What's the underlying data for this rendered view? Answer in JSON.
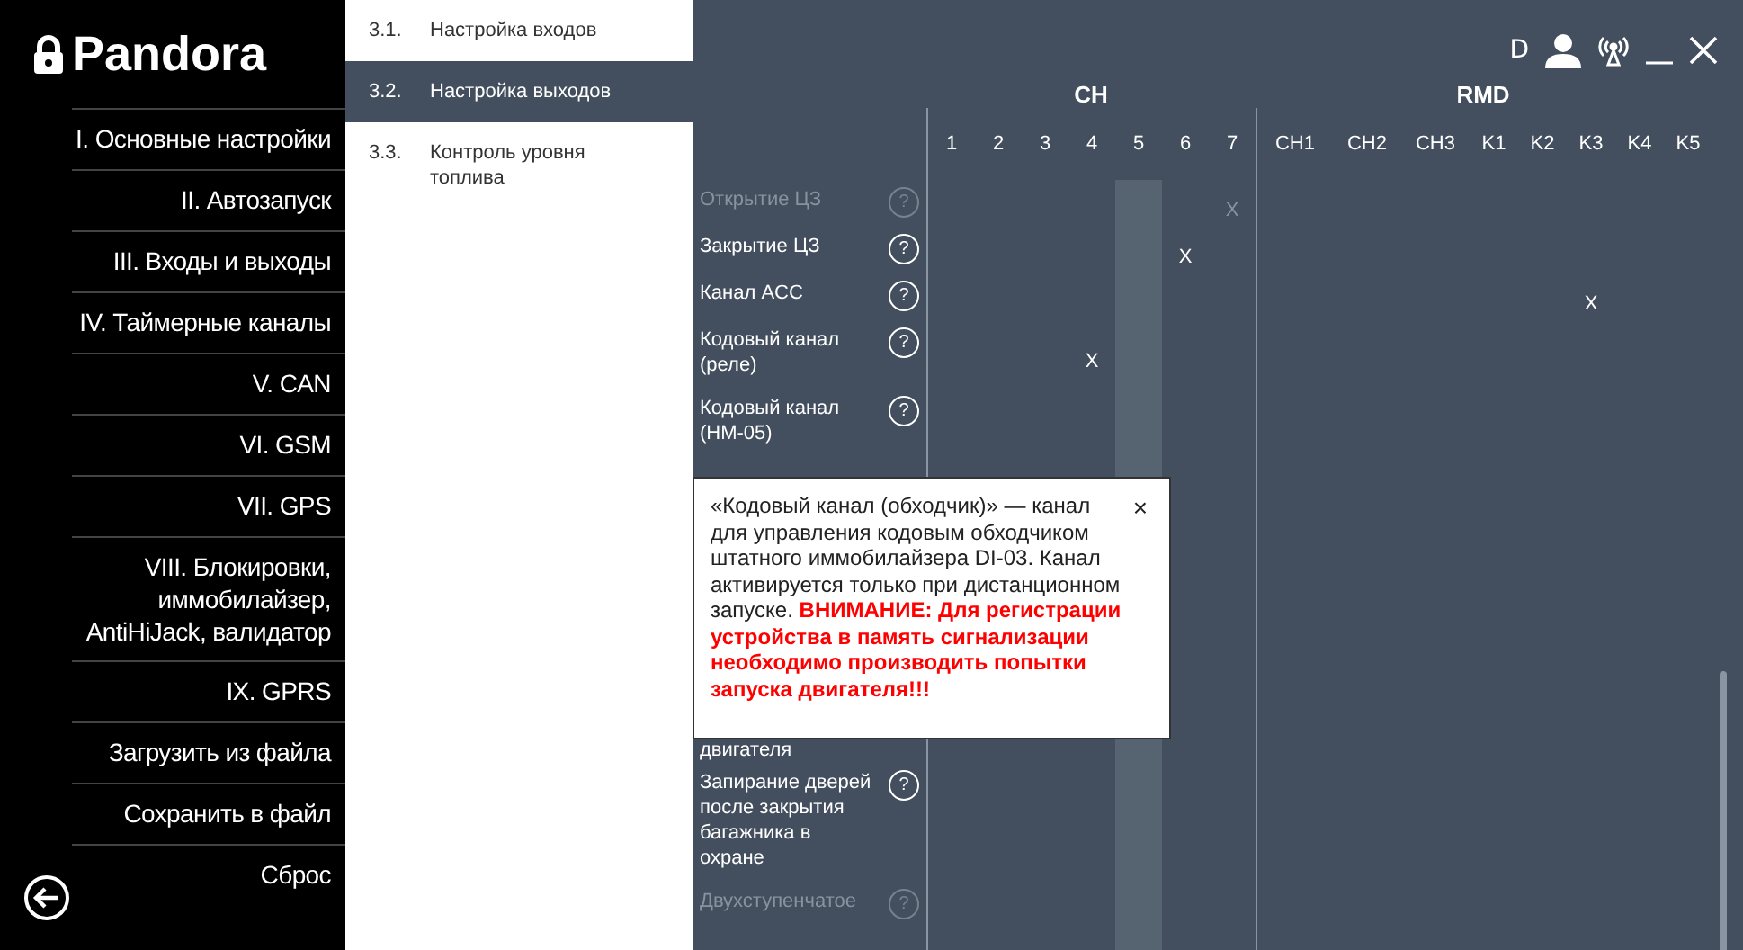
{
  "logo": {
    "text": "Pandora"
  },
  "menu": [
    {
      "label": "I. Основные настройки"
    },
    {
      "label": "II. Автозапуск"
    },
    {
      "label": "III. Входы и выходы"
    },
    {
      "label": "IV. Таймерные каналы"
    },
    {
      "label": "V. CAN"
    },
    {
      "label": "VI. GSM"
    },
    {
      "label": "VII. GPS"
    },
    {
      "label": "VIII. Блокировки, иммобилайзер, AntiHiJack, валидатор"
    },
    {
      "label": "IX. GPRS"
    },
    {
      "label": "Загрузить из файла"
    },
    {
      "label": "Сохранить в файл"
    },
    {
      "label": "Сброс"
    }
  ],
  "submenu": [
    {
      "number": "3.1.",
      "label": "Настройка входов",
      "selected": false
    },
    {
      "number": "3.2.",
      "label": "Настройка выходов",
      "selected": true
    },
    {
      "number": "3.3.",
      "label": "Контроль уровня топлива",
      "selected": false
    }
  ],
  "header": {
    "device_letter": "D"
  },
  "table": {
    "help_symbol": "?",
    "groups": [
      {
        "label": "CH",
        "columns": [
          {
            "label": "1",
            "selected": false
          },
          {
            "label": "2",
            "selected": false
          },
          {
            "label": "3",
            "selected": false
          },
          {
            "label": "4",
            "selected": false
          },
          {
            "label": "5",
            "selected": true
          },
          {
            "label": "6",
            "selected": false
          },
          {
            "label": "7",
            "selected": false
          }
        ]
      },
      {
        "label": "RMD",
        "columns": [
          {
            "label": "CH1",
            "selected": false
          },
          {
            "label": "CH2",
            "selected": false
          },
          {
            "label": "CH3",
            "selected": false
          },
          {
            "label": "K1",
            "selected": false
          },
          {
            "label": "K2",
            "selected": false
          },
          {
            "label": "K3",
            "selected": false
          },
          {
            "label": "K4",
            "selected": false
          },
          {
            "label": "K5",
            "selected": false
          }
        ]
      }
    ],
    "rows": [
      {
        "kind": "row",
        "label": "Открытие ЦЗ",
        "faded": true,
        "cells": [
          {},
          {},
          {},
          {},
          {},
          {},
          {
            "text": "X"
          },
          {},
          {},
          {},
          {},
          {},
          {},
          {},
          {}
        ]
      },
      {
        "kind": "row",
        "label": "Закрытие ЦЗ",
        "faded": false,
        "cells": [
          {},
          {},
          {},
          {},
          {},
          {
            "text": "X"
          },
          {},
          {},
          {},
          {},
          {},
          {},
          {},
          {},
          {}
        ]
      },
      {
        "kind": "row",
        "label": "Канал ACC",
        "faded": false,
        "cells": [
          {},
          {},
          {},
          {},
          {},
          {},
          {},
          {},
          {},
          {},
          {},
          {},
          {
            "text": "X"
          },
          {},
          {}
        ]
      },
      {
        "kind": "row",
        "label": "Кодовый канал (реле)",
        "faded": false,
        "cells": [
          {},
          {},
          {},
          {
            "text": "X"
          },
          {},
          {},
          {},
          {},
          {},
          {},
          {},
          {},
          {},
          {},
          {}
        ]
      },
      {
        "kind": "row",
        "label": "Кодовый канал (HM-05)",
        "faded": false
      },
      {
        "kind": "tail",
        "label": "двигателя",
        "faded": false
      },
      {
        "kind": "row",
        "label": "Запирание дверей после закрытия багажника в охране",
        "faded": false
      },
      {
        "kind": "row",
        "label": "Двухступенчатое",
        "faded": true
      }
    ]
  },
  "tooltip": {
    "text": "«Кодовый канал (обходчик)» — канал для управления кодовым обходчиком штатного иммобилайзера DI-03. Канал активируется только при дистанционном запуске.",
    "warning": "ВНИМАНИЕ: Для регистрации устройства в память сигнализации необходимо производить попытки запуска двигателя!!!",
    "close": "×"
  }
}
